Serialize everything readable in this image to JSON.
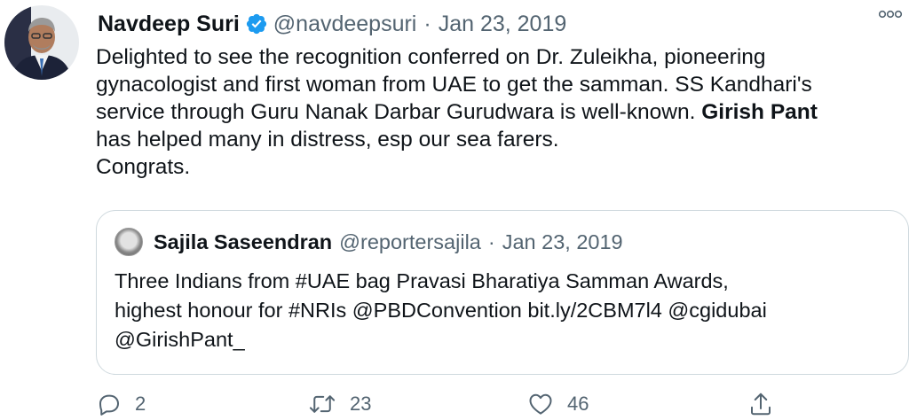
{
  "tweet": {
    "author_name": "Navdeep Suri",
    "handle": "@navdeepsuri",
    "separator": "·",
    "date": "Jan 23, 2019",
    "text_lines": [
      {
        "plain": "Delighted to see the recognition conferred on Dr. Zuleikha, pioneering"
      },
      {
        "plain": "gynacologist and first woman from UAE to get the samman. SS Kandhari's"
      },
      {
        "plain": "service through Guru Nanak Darbar Gurudwara is well-known. ",
        "bold": "Girish Pant"
      },
      {
        "plain": "has helped many in distress,  esp our sea farers."
      },
      {
        "plain": "Congrats."
      }
    ],
    "icons": {
      "verified": "verified-badge-icon",
      "more": "more-options-icon"
    },
    "colors": {
      "verified": "#1d9bf0",
      "secondary_text": "#536471",
      "primary_text": "#0f1419",
      "card_border": "#cfd9de"
    }
  },
  "quoted_tweet": {
    "author_name": "Sajila Saseendran",
    "handle": "@reportersajila",
    "separator": "·",
    "date": "Jan 23, 2019",
    "text_lines": [
      "Three Indians from #UAE bag Pravasi Bharatiya Samman Awards,",
      "highest honour for #NRIs @PBDConvention bit.ly/2CBM7l4 @cgidubai",
      "@GirishPant_"
    ]
  },
  "actions": {
    "reply": {
      "icon": "reply-icon",
      "count": "2"
    },
    "retweet": {
      "icon": "retweet-icon",
      "count": "23"
    },
    "like": {
      "icon": "heart-icon",
      "count": "46"
    },
    "share": {
      "icon": "share-icon"
    }
  }
}
